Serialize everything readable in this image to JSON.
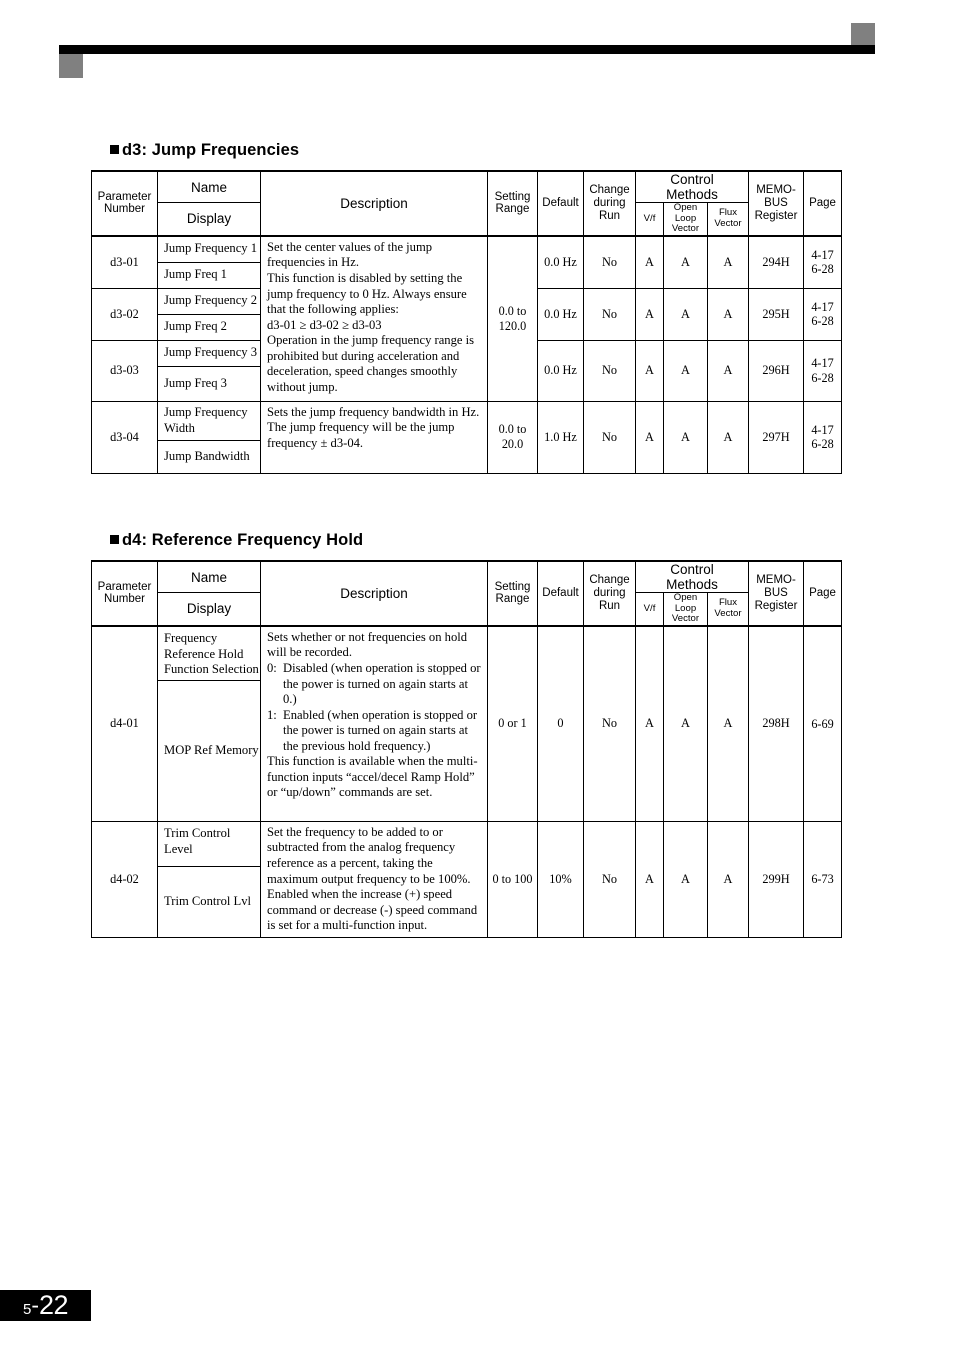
{
  "page": {
    "section": "5",
    "dash": "-",
    "number": "22"
  },
  "sections": [
    {
      "id": "d3",
      "heading": "d3: Jump Frequencies"
    },
    {
      "id": "d4",
      "heading": "d4: Reference Frequency Hold"
    }
  ],
  "table_headers": {
    "parameter_number": "Parameter\nNumber",
    "name": "Name",
    "display": "Display",
    "description": "Description",
    "setting_range": "Setting\nRange",
    "default": "Default",
    "change_during_run": "Change\nduring\nRun",
    "control_methods": "Control\nMethods",
    "vf": "V/f",
    "open_loop_vector": "Open\nLoop\nVector",
    "flux_vector": "Flux\nVector",
    "memobus_register": "MEMO-\nBUS\nRegister",
    "page": "Page"
  },
  "d3_table": {
    "rows": [
      {
        "param": "d3-01",
        "name": "Jump Frequency 1",
        "display": "Jump Freq 1",
        "setting_range": "",
        "default": "0.0 Hz",
        "change": "No",
        "vf": "A",
        "olv": "A",
        "fv": "A",
        "register": "294H",
        "page": "4-17\n6-28"
      },
      {
        "param": "d3-02",
        "name": "Jump Frequency 2",
        "display": "Jump Freq 2",
        "setting_range": "0.0 to\n120.0",
        "default": "0.0 Hz",
        "change": "No",
        "vf": "A",
        "olv": "A",
        "fv": "A",
        "register": "295H",
        "page": "4-17\n6-28"
      },
      {
        "param": "d3-03",
        "name": "Jump Frequency 3",
        "display": "Jump Freq 3",
        "setting_range": "",
        "default": "0.0 Hz",
        "change": "No",
        "vf": "A",
        "olv": "A",
        "fv": "A",
        "register": "296H",
        "page": "4-17\n6-28"
      },
      {
        "param": "d3-04",
        "name": "Jump Frequency Width",
        "display": "Jump Bandwidth",
        "setting_range": "0.0 to\n20.0",
        "default": "1.0 Hz",
        "change": "No",
        "vf": "A",
        "olv": "A",
        "fv": "A",
        "register": "297H",
        "page": "4-17\n6-28"
      }
    ],
    "description_jump": "Set the center values of the jump frequencies in Hz.\nThis function is disabled by setting the jump frequency to 0 Hz. Always ensure that the following applies:\nd3-01 ≥ d3-02 ≥ d3-03\nOperation in the jump frequency range is prohibited but during acceleration and deceleration, speed changes smoothly without jump.",
    "description_width": "Sets the jump frequency bandwidth in Hz.\nThe jump frequency will be the jump frequency ± d3-04."
  },
  "d4_table": {
    "rows": [
      {
        "param": "d4-01",
        "name": "Frequency Reference Hold Function Selection",
        "display": "MOP Ref Memory",
        "setting_range": "0 or 1",
        "default": "0",
        "change": "No",
        "vf": "A",
        "olv": "A",
        "fv": "A",
        "register": "298H",
        "page": "6-69"
      },
      {
        "param": "d4-02",
        "name": "Trim Control Level",
        "display": "Trim Control Lvl",
        "setting_range": "0 to 100",
        "default": "10%",
        "change": "No",
        "vf": "A",
        "olv": "A",
        "fv": "A",
        "register": "299H",
        "page": "6-73"
      }
    ],
    "description_d4_01_intro": "Sets whether or not frequencies on hold will be recorded.",
    "description_d4_01_opt0_marker": "0:",
    "description_d4_01_opt0_text": "Disabled (when operation is stopped or the power is turned on again starts at 0.)",
    "description_d4_01_opt1_marker": "1:",
    "description_d4_01_opt1_text": "Enabled (when operation is stopped or the power is turned on again starts at the previous hold frequency.)",
    "description_d4_01_outro": "This function is available when the multi-function inputs “accel/decel Ramp Hold” or “up/down” commands are set.",
    "description_d4_02": "Set the frequency to be added to or subtracted from the analog frequency reference as a percent, taking the maximum output frequency to be 100%.\nEnabled when the increase (+) speed command or decrease (-) speed command is set for a multi-function input."
  }
}
